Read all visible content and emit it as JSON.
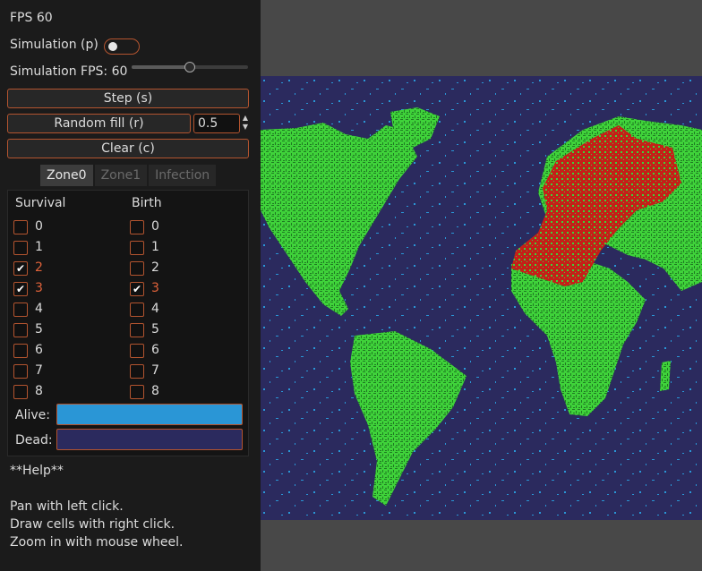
{
  "fps_label": "FPS 60",
  "simulation": {
    "label": "Simulation (p)",
    "enabled": false
  },
  "sim_fps": {
    "label": "Simulation FPS: 60",
    "value": 60
  },
  "buttons": {
    "step": "Step (s)",
    "random_fill": "Random fill (r)",
    "clear": "Clear (c)"
  },
  "random_fill_value": "0.5",
  "tabs": [
    {
      "label": "Zone0",
      "active": true
    },
    {
      "label": "Zone1",
      "active": false
    },
    {
      "label": "Infection",
      "active": false
    }
  ],
  "zone": {
    "survival_header": "Survival",
    "birth_header": "Birth",
    "survival": [
      {
        "n": "0",
        "checked": false
      },
      {
        "n": "1",
        "checked": false
      },
      {
        "n": "2",
        "checked": true
      },
      {
        "n": "3",
        "checked": true
      },
      {
        "n": "4",
        "checked": false
      },
      {
        "n": "5",
        "checked": false
      },
      {
        "n": "6",
        "checked": false
      },
      {
        "n": "7",
        "checked": false
      },
      {
        "n": "8",
        "checked": false
      }
    ],
    "birth": [
      {
        "n": "0",
        "checked": false
      },
      {
        "n": "1",
        "checked": false
      },
      {
        "n": "2",
        "checked": false
      },
      {
        "n": "3",
        "checked": true
      },
      {
        "n": "4",
        "checked": false
      },
      {
        "n": "5",
        "checked": false
      },
      {
        "n": "6",
        "checked": false
      },
      {
        "n": "7",
        "checked": false
      },
      {
        "n": "8",
        "checked": false
      }
    ],
    "alive_label": "Alive:",
    "alive_color": "#2a96d6",
    "dead_label": "Dead:",
    "dead_color": "#2b2a5e"
  },
  "help": {
    "title": "**Help**",
    "lines": [
      "Pan with left click.",
      "Draw cells with right click.",
      "Zoom in with mouse wheel."
    ]
  },
  "map_colors": {
    "ocean": "#2b2a5e",
    "land": "#3fd23a",
    "land_dark": "#1f7a22",
    "infection": "#c42018",
    "noise": "#2a96d6"
  }
}
